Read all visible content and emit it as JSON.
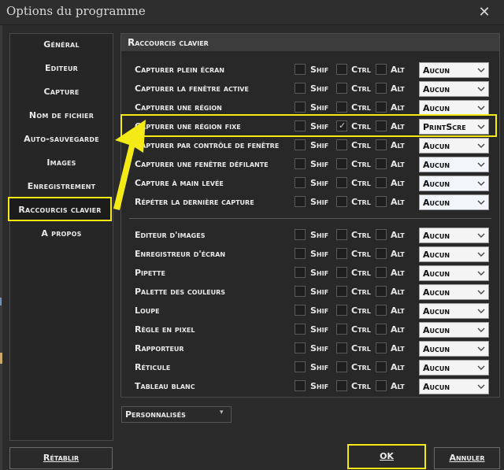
{
  "window": {
    "title": "Options du programme",
    "close_glyph": "✕"
  },
  "sidebar": {
    "items": [
      {
        "label": "Général"
      },
      {
        "label": "Editeur"
      },
      {
        "label": "Capture"
      },
      {
        "label": "Nom de fichier"
      },
      {
        "label": "Auto-sauvegarde"
      },
      {
        "label": "Images"
      },
      {
        "label": "Enregistrement"
      },
      {
        "label": "Raccourcis clavier",
        "active": true
      },
      {
        "label": "A propos"
      }
    ]
  },
  "panel": {
    "title": "Raccourcis clavier",
    "modifier_labels": {
      "shift": "Shif",
      "ctrl": "Ctrl",
      "alt": "Alt"
    },
    "capture_rows": [
      {
        "label": "Capturer plein écran",
        "shift": false,
        "ctrl": false,
        "alt": false,
        "key": "Aucun"
      },
      {
        "label": "Capturer la fenêtre active",
        "shift": false,
        "ctrl": false,
        "alt": false,
        "key": "Aucun"
      },
      {
        "label": "Capturer une région",
        "shift": false,
        "ctrl": false,
        "alt": false,
        "key": "Aucun"
      },
      {
        "label": "Capturer une région fixe",
        "shift": false,
        "ctrl": true,
        "alt": false,
        "key": "PrintScre",
        "highlighted": true
      },
      {
        "label": "Capturer par contrôle de fenêtre",
        "shift": false,
        "ctrl": false,
        "alt": false,
        "key": "Aucun"
      },
      {
        "label": "Capturer une fenêtre défilante",
        "shift": false,
        "ctrl": false,
        "alt": false,
        "key": "Aucun"
      },
      {
        "label": "Capture à main levée",
        "shift": false,
        "ctrl": false,
        "alt": false,
        "key": "Aucun"
      },
      {
        "label": "Répéter la dernière capture",
        "shift": false,
        "ctrl": false,
        "alt": false,
        "key": "Aucun"
      }
    ],
    "tool_rows": [
      {
        "label": "Editeur d'images",
        "shift": false,
        "ctrl": false,
        "alt": false,
        "key": "Aucun"
      },
      {
        "label": "Enregistreur d'écran",
        "shift": false,
        "ctrl": false,
        "alt": false,
        "key": "Aucun"
      },
      {
        "label": "Pipette",
        "shift": false,
        "ctrl": false,
        "alt": false,
        "key": "Aucun"
      },
      {
        "label": "Palette des couleurs",
        "shift": false,
        "ctrl": false,
        "alt": false,
        "key": "Aucun"
      },
      {
        "label": "Loupe",
        "shift": false,
        "ctrl": false,
        "alt": false,
        "key": "Aucun"
      },
      {
        "label": "Règle en pixel",
        "shift": false,
        "ctrl": false,
        "alt": false,
        "key": "Aucun"
      },
      {
        "label": "Rapporteur",
        "shift": false,
        "ctrl": false,
        "alt": false,
        "key": "Aucun"
      },
      {
        "label": "Réticule",
        "shift": false,
        "ctrl": false,
        "alt": false,
        "key": "Aucun"
      },
      {
        "label": "Tableau blanc",
        "shift": false,
        "ctrl": false,
        "alt": false,
        "key": "Aucun"
      }
    ]
  },
  "preset": {
    "value": "Personnalisés",
    "caret_glyph": "▾"
  },
  "buttons": {
    "reset": "Rétablir",
    "ok": "OK",
    "cancel": "Annuler"
  },
  "colors": {
    "highlight": "#f4ea16",
    "background": "#2b2b2b",
    "panel_header": "#3c3c3c"
  },
  "icons": {
    "checkmark": "✓",
    "dropdown": "chevron-down-icon",
    "annotation": "arrow-annotation"
  }
}
